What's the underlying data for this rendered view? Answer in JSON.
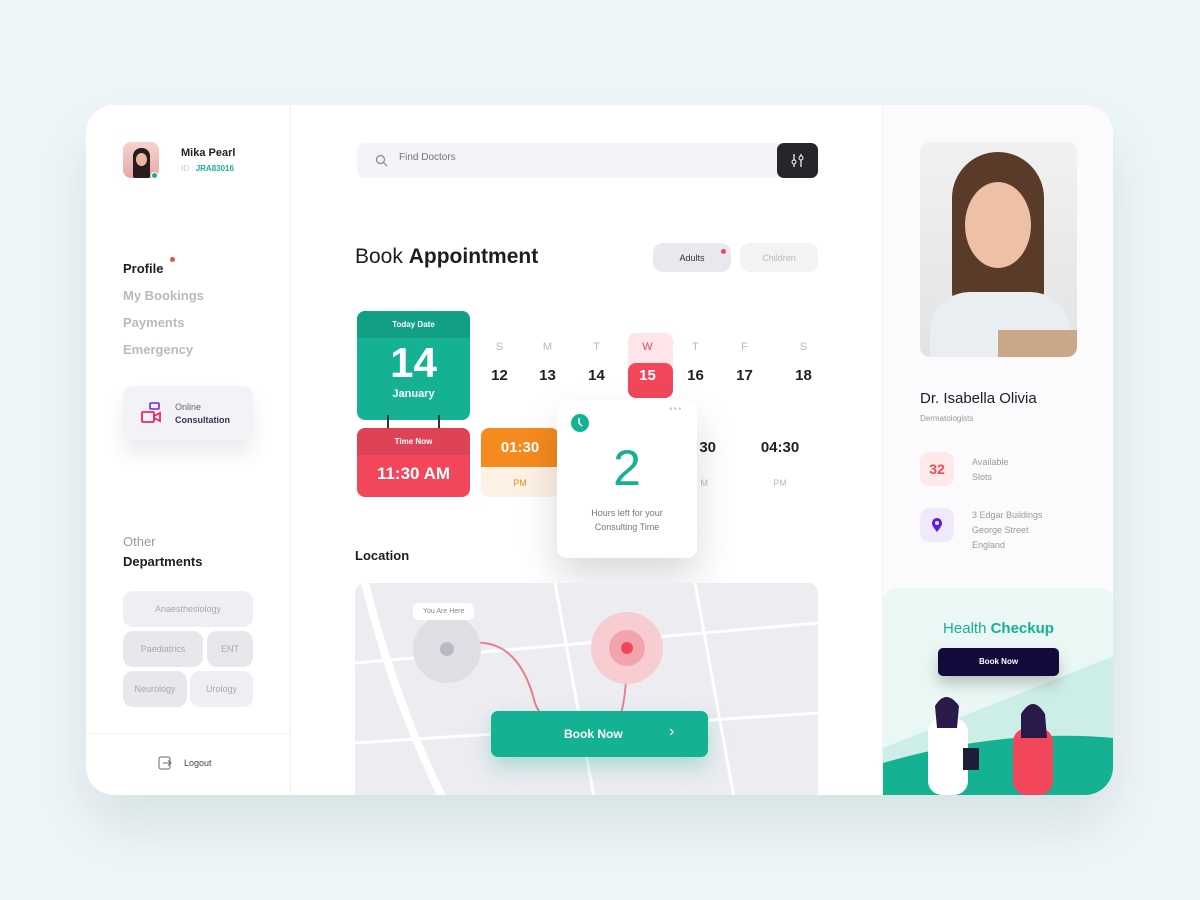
{
  "user": {
    "name": "Mika Pearl",
    "id_label": "ID :",
    "id": "JRA83016"
  },
  "nav": [
    {
      "label": "Profile",
      "active": true
    },
    {
      "label": "My Bookings"
    },
    {
      "label": "Payments"
    },
    {
      "label": "Emergency"
    }
  ],
  "consult": {
    "line1": "Online",
    "line2": "Consultation",
    "icon": "video-chat-icon"
  },
  "departments": {
    "title1": "Other",
    "title2": "Departments",
    "items": [
      "Anaesthesiology",
      "Paediatrics",
      "ENT",
      "Neurology",
      "Urology"
    ]
  },
  "logout": "Logout",
  "search": {
    "placeholder": "Find Doctors"
  },
  "title": {
    "light": "Book",
    "bold": "Appointment"
  },
  "tabs": [
    "Adults",
    "Children"
  ],
  "today": {
    "label": "Today Date",
    "day": "14",
    "month": "January"
  },
  "time": {
    "label": "Time Now",
    "value": "11:30 AM"
  },
  "week": [
    {
      "l": "S",
      "n": "12"
    },
    {
      "l": "M",
      "n": "13"
    },
    {
      "l": "T",
      "n": "14"
    },
    {
      "l": "W",
      "n": "15",
      "selected": true
    },
    {
      "l": "T",
      "n": "16"
    },
    {
      "l": "F",
      "n": "17"
    },
    {
      "l": "S",
      "n": "18"
    }
  ],
  "slots": [
    {
      "time": "01:30",
      "period": "PM",
      "selected": true
    },
    {
      "time": "30",
      "period": "M"
    },
    {
      "time": "04:30",
      "period": "PM"
    }
  ],
  "popup": {
    "number": "2",
    "line1": "Hours left for your",
    "line2": "Consulting Time"
  },
  "location": {
    "title": "Location",
    "you_are_here": "You Are Here",
    "button": "Book Now"
  },
  "doctor": {
    "name": "Dr. Isabella Olivia",
    "specialty": "Dermatologists",
    "slots": "32",
    "slots_l1": "Available",
    "slots_l2": "Slots",
    "addr": [
      "3 Edgar Buildings",
      "George Street",
      "England"
    ]
  },
  "health": {
    "light": "Health",
    "bold": "Checkup",
    "button": "Book Now"
  },
  "colors": {
    "teal": "#14b292",
    "red": "#f2475b",
    "orange": "#f58a1f",
    "navy": "#120a3b"
  }
}
